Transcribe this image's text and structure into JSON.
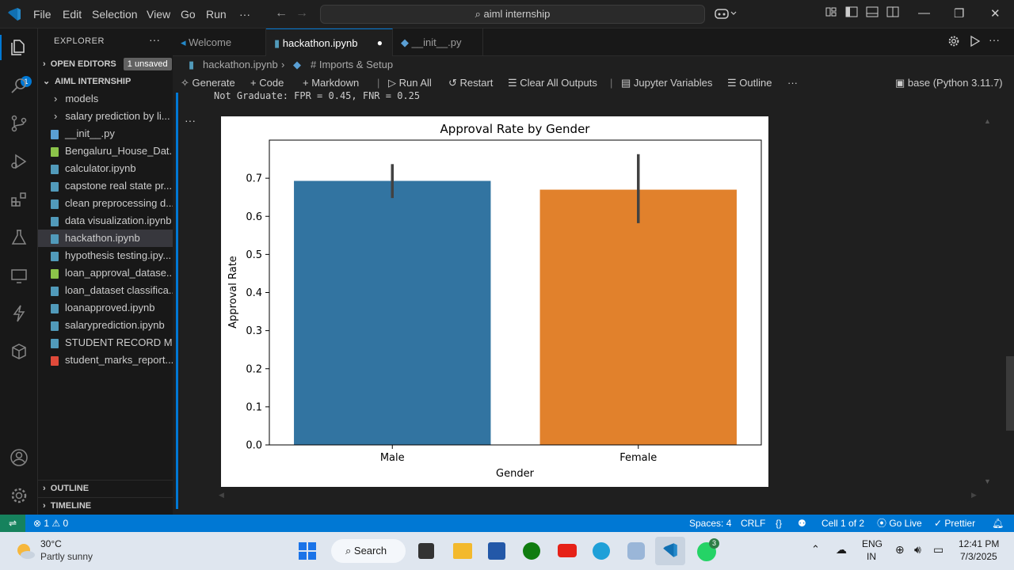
{
  "titlebar": {
    "menus": [
      "File",
      "Edit",
      "Selection",
      "View",
      "Go",
      "Run",
      "···"
    ],
    "search_text": "aiml internship"
  },
  "activity": {
    "badge": "1"
  },
  "sidebar": {
    "title": "EXPLORER",
    "open_editors_label": "OPEN EDITORS",
    "unsaved_label": "1 unsaved",
    "workspace_label": "AIML INTERNSHIP",
    "items": [
      {
        "label": "models",
        "kind": "folder"
      },
      {
        "label": "salary prediction by li...",
        "kind": "folder"
      },
      {
        "label": "__init__.py",
        "kind": "python"
      },
      {
        "label": "Bengaluru_House_Dat...",
        "kind": "csv"
      },
      {
        "label": "calculator.ipynb",
        "kind": "notebook"
      },
      {
        "label": "capstone real state pr...",
        "kind": "notebook"
      },
      {
        "label": "clean preprocessing d...",
        "kind": "notebook"
      },
      {
        "label": "data visualization.ipynb",
        "kind": "notebook"
      },
      {
        "label": "hackathon.ipynb",
        "kind": "notebook"
      },
      {
        "label": "hypothesis testing.ipy...",
        "kind": "notebook"
      },
      {
        "label": "loan_approval_datase...",
        "kind": "csv"
      },
      {
        "label": "loan_dataset classifica...",
        "kind": "notebook"
      },
      {
        "label": "loanapproved.ipynb",
        "kind": "notebook"
      },
      {
        "label": "salaryprediction.ipynb",
        "kind": "notebook"
      },
      {
        "label": "STUDENT RECORD M...",
        "kind": "notebook"
      },
      {
        "label": "student_marks_report...",
        "kind": "pdf"
      }
    ],
    "outline_label": "OUTLINE",
    "timeline_label": "TIMELINE"
  },
  "tabs": [
    {
      "label": "Welcome"
    },
    {
      "label": "hackathon.ipynb"
    },
    {
      "label": "__init__.py"
    }
  ],
  "breadcrumb": {
    "file": "hackathon.ipynb",
    "section": "# Imports & Setup"
  },
  "toolbar": {
    "generate": "Generate",
    "code": "Code",
    "markdown": "Markdown",
    "run_all": "Run All",
    "restart": "Restart",
    "clear_outputs": "Clear All Outputs",
    "variables": "Jupyter Variables",
    "outline": "Outline",
    "more": "···",
    "kernel": "base (Python 3.11.7)"
  },
  "editor": {
    "previous_output": "Not Graduate: FPR = 0.45, FNR = 0.25",
    "cell_menu": "···"
  },
  "chart_data": {
    "type": "bar",
    "title": "Approval Rate by Gender",
    "xlabel": "Gender",
    "ylabel": "Approval Rate",
    "categories": [
      "Male",
      "Female"
    ],
    "values": [
      0.693,
      0.67
    ],
    "error_low": [
      0.648,
      0.582
    ],
    "error_high": [
      0.737,
      0.763
    ],
    "colors": [
      "#3274a1",
      "#e1812c"
    ],
    "ylim": [
      0,
      0.8
    ],
    "yticks": [
      "0.0",
      "0.1",
      "0.2",
      "0.3",
      "0.4",
      "0.5",
      "0.6",
      "0.7"
    ],
    "grid": false
  },
  "statusbar": {
    "errors": "1",
    "warnings": "0",
    "spaces": "Spaces: 4",
    "eol": "CRLF",
    "braces": "{}",
    "cell": "Cell 1 of 2",
    "golive": "Go Live",
    "prettier": "Prettier"
  },
  "taskbar": {
    "weather_temp": "30°C",
    "weather_desc": "Partly sunny",
    "search": "Search",
    "lang_top": "ENG",
    "lang_bottom": "IN",
    "time": "12:41 PM",
    "date": "7/3/2025",
    "whatsapp_badge": "3"
  }
}
